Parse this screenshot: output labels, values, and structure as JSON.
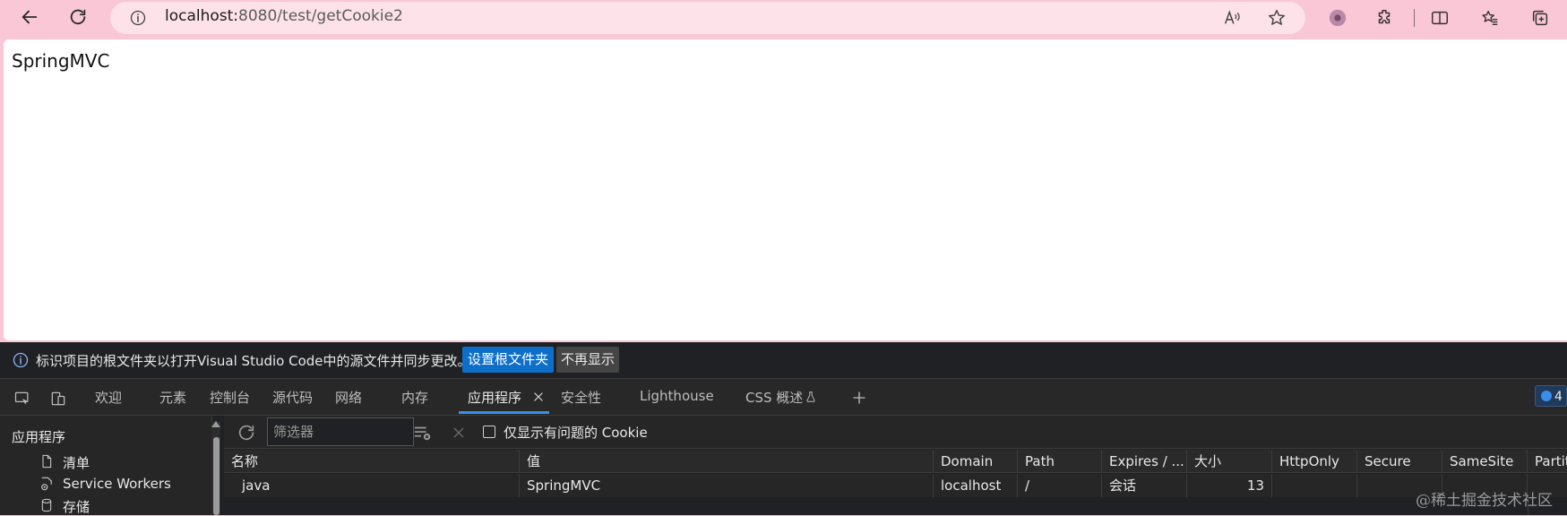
{
  "browser": {
    "url_host": "localhost:",
    "url_rest": "8080/test/getCookie2"
  },
  "page": {
    "content_text": "SpringMVC"
  },
  "devtools": {
    "infobar": {
      "message": "标识项目的根文件夹以打开Visual Studio Code中的源文件并同步更改。",
      "set_root_button": "设置根文件夹",
      "dismiss_button": "不再显示"
    },
    "tabs": [
      {
        "label": "欢迎"
      },
      {
        "label": "元素"
      },
      {
        "label": "控制台"
      },
      {
        "label": "源代码"
      },
      {
        "label": "网络"
      },
      {
        "label": "内存"
      },
      {
        "label": "应用程序"
      },
      {
        "label": "安全性"
      },
      {
        "label": "Lighthouse"
      },
      {
        "label": "CSS 概述"
      }
    ],
    "issues_count": "4",
    "sidebar": {
      "title": "应用程序",
      "items": [
        {
          "label": "清单"
        },
        {
          "label": "Service Workers"
        },
        {
          "label": "存储"
        }
      ]
    },
    "cookie_toolbar": {
      "filter_placeholder": "筛选器",
      "only_issues_label": "仅显示有问题的 Cookie"
    },
    "table": {
      "columns": [
        "名称",
        "值",
        "Domain",
        "Path",
        "Expires / ...",
        "大小",
        "HttpOnly",
        "Secure",
        "SameSite",
        "Partiti"
      ],
      "rows": [
        [
          "java",
          "SpringMVC",
          "localhost",
          "/",
          "会话",
          "13",
          "",
          "",
          "",
          ""
        ]
      ]
    },
    "watermark": "@稀土掘金技术社区"
  }
}
